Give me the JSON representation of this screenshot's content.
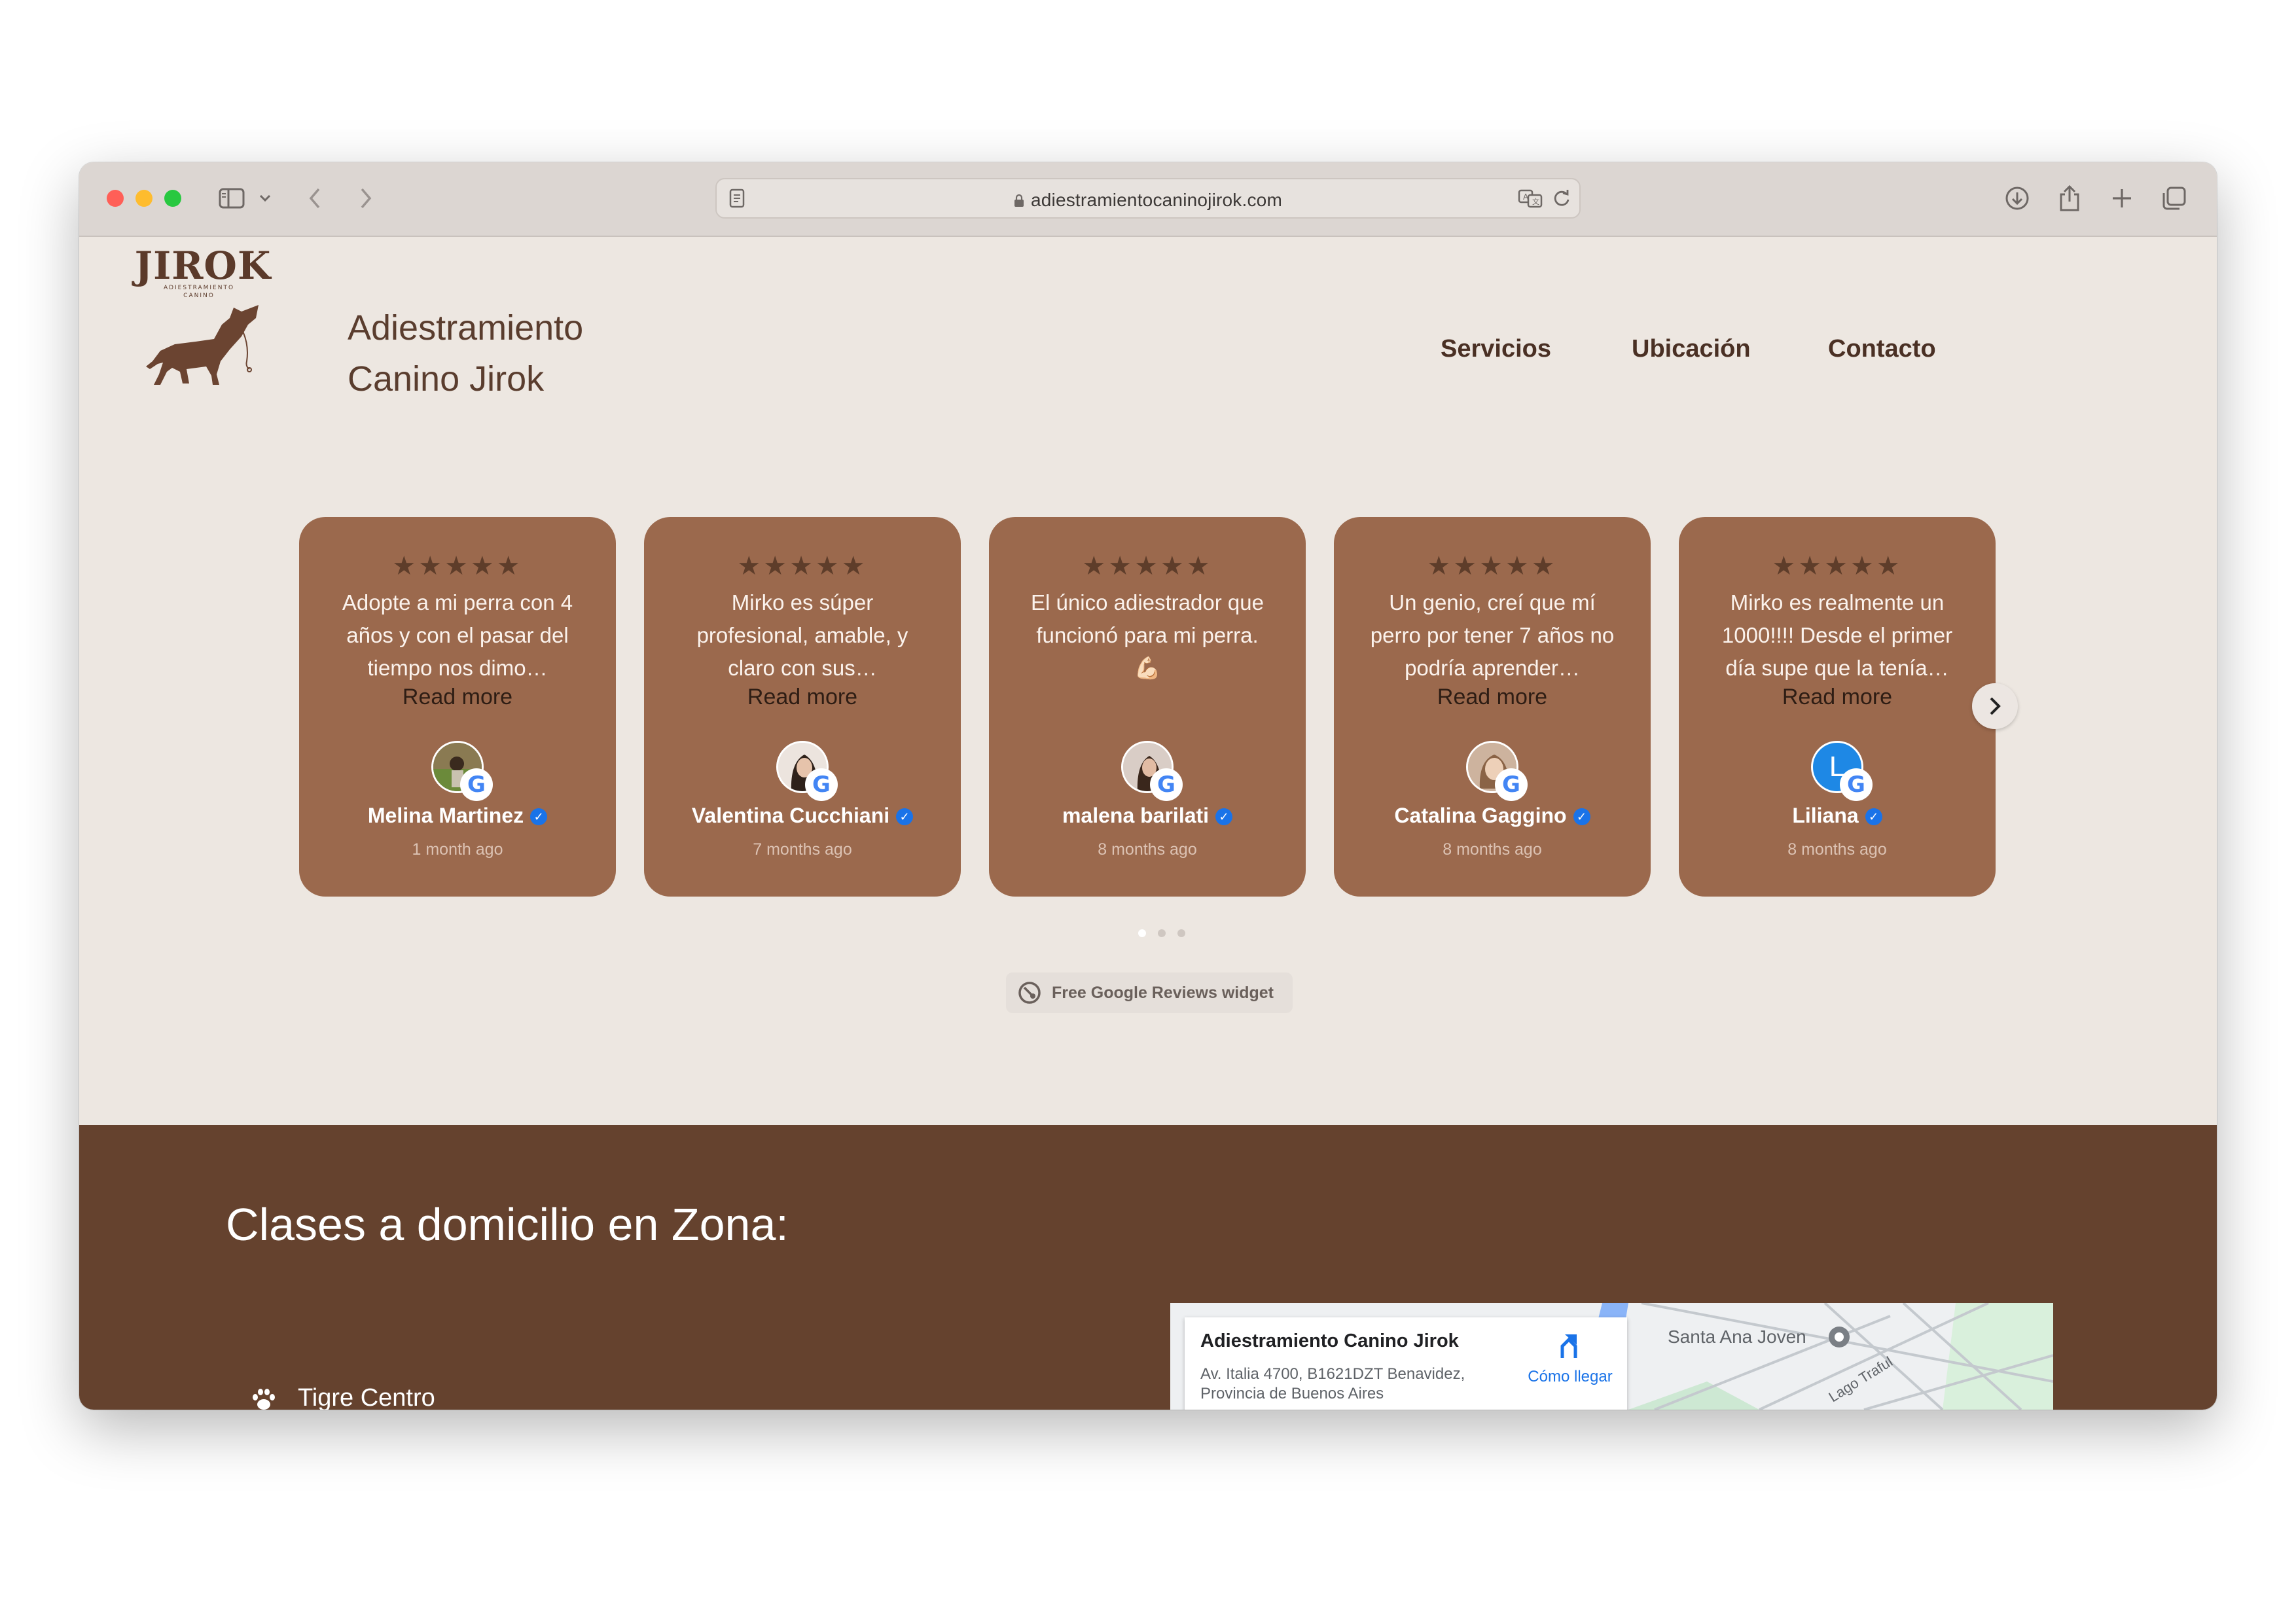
{
  "browser": {
    "url": "adiestramientocaninojirok.com"
  },
  "site": {
    "logo_word": "JIROK",
    "logo_sub_1": "ADIESTRAMIENTO",
    "logo_sub_2": "CANINO",
    "brand_line_1": "Adiestramiento",
    "brand_line_2": "Canino Jirok",
    "nav": [
      "Servicios",
      "Ubicación",
      "Contacto"
    ]
  },
  "reviews": [
    {
      "stars": "★★★★★",
      "text": "Adopte a mi perra con 4 años y con el pasar del tiempo nos dimo…",
      "read_more": "Read more",
      "name": "Melina Martinez",
      "time": "1 month ago",
      "avatar_color": "#8a7a52"
    },
    {
      "stars": "★★★★★",
      "text": "Mirko es súper profesional, amable, y claro con sus…",
      "read_more": "Read more",
      "name": "Valentina Cucchiani",
      "time": "7 months ago",
      "avatar_color": "#e9dfd8"
    },
    {
      "stars": "★★★★★",
      "text": "El único adiestrador que funcionó para mi perra. 💪🏻",
      "read_more": "",
      "name": "malena barilati",
      "time": "8 months ago",
      "avatar_color": "#d6c8c0"
    },
    {
      "stars": "★★★★★",
      "text": "Un genio, creí que mí perro por tener 7 años no podría aprender…",
      "read_more": "Read more",
      "name": "Catalina Gaggino",
      "time": "8 months ago",
      "avatar_color": "#c9a98f"
    },
    {
      "stars": "★★★★★",
      "text": "Mirko es realmente un 1000!!!! Desde el primer día supe que la tenía…",
      "read_more": "Read more",
      "name": "Liliana",
      "time": "8 months ago",
      "avatar_color": "#1e88e5",
      "avatar_letter": "L"
    }
  ],
  "carousel": {
    "next_glyph": "›",
    "pages": 3,
    "active_page": 1
  },
  "widget_label": "Free Google Reviews widget",
  "zones": {
    "title": "Clases a domicilio en Zona:",
    "first_item": "Tigre Centro"
  },
  "map": {
    "name": "Adiestramiento Canino Jirok",
    "address": "Av. Italia 4700, B1621DZT Benavidez, Provincia de Buenos Aires",
    "directions": "Cómo llegar",
    "place_label": "Santa Ana Joven",
    "road_label": "Lago Traful"
  },
  "colors": {
    "page_bg": "#ede7e1",
    "card_bg": "#9b694d",
    "section_bg": "#65422e",
    "nav_text": "#4a3024"
  }
}
